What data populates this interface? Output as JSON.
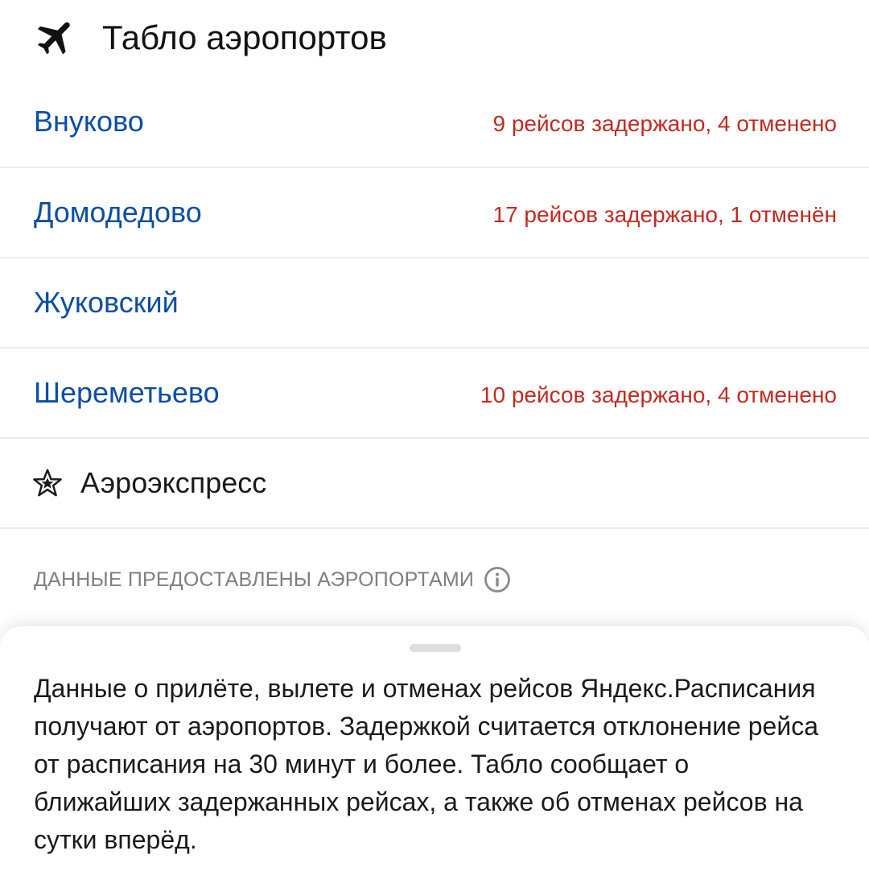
{
  "header": {
    "title": "Табло аэропортов",
    "icon": "airplane-icon"
  },
  "airports": [
    {
      "name": "Внуково",
      "status": "9 рейсов задержано, 4 отменено"
    },
    {
      "name": "Домодедово",
      "status": "17 рейсов задержано, 1 отменён"
    },
    {
      "name": "Жуковский",
      "status": ""
    },
    {
      "name": "Шереметьево",
      "status": "10 рейсов задержано, 4 отменено"
    }
  ],
  "aeroexpress": {
    "label": "Аэроэкспресс",
    "icon": "aeroexpress-star-icon"
  },
  "source": {
    "label": "ДАННЫЕ ПРЕДОСТАВЛЕНЫ АЭРОПОРТАМИ",
    "icon": "info-icon"
  },
  "sheet": {
    "text": "Данные о прилёте, вылете и отменах рейсов Яндекс.Расписания получают от аэропортов. Задержкой считается отклонение рейса от расписания на 30 минут и более. Табло сообщает о ближайших задержанных рейсах, а также об отменах рейсов на сутки вперёд."
  },
  "colors": {
    "link": "#0d4ea4",
    "alert": "#c22a22",
    "muted": "#7f7f7f"
  }
}
